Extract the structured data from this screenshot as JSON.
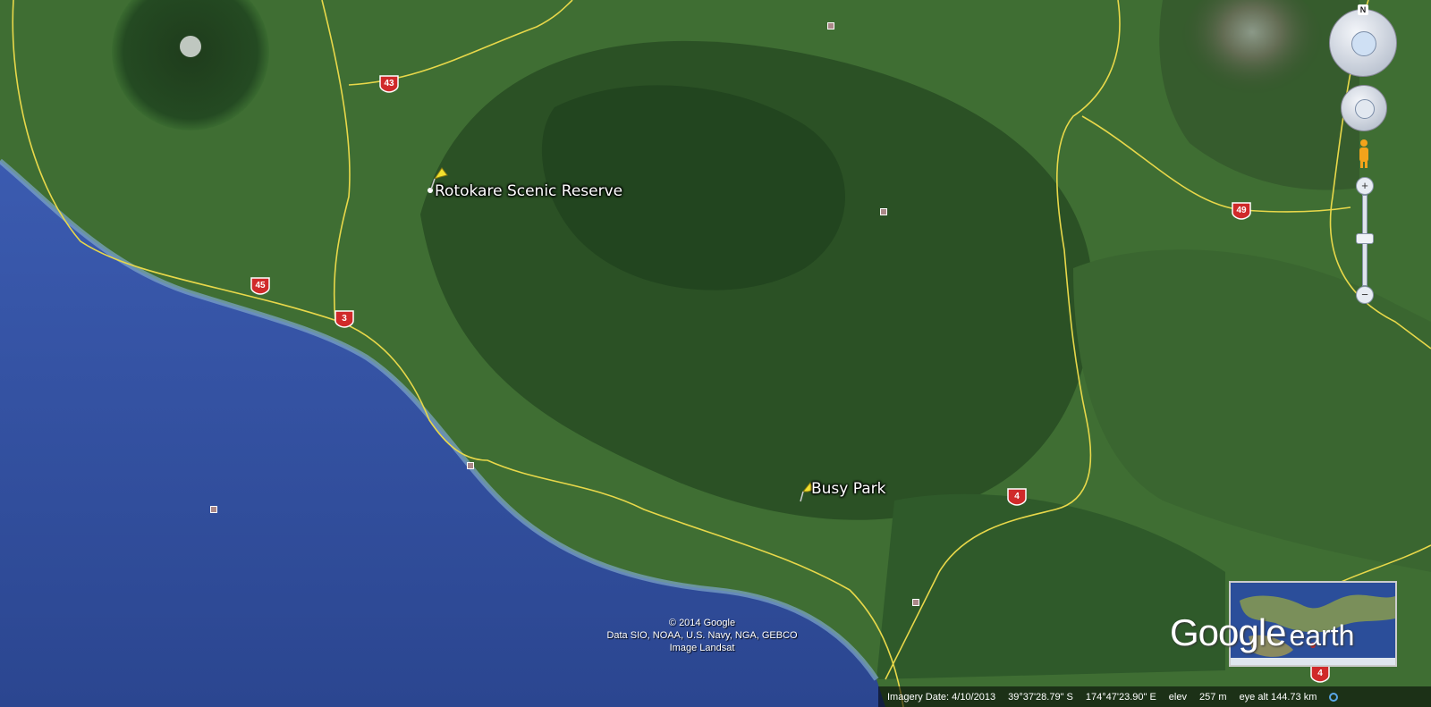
{
  "places": [
    {
      "name": "Rotokare Scenic Reserve"
    },
    {
      "name": "Busy Park"
    }
  ],
  "highways": [
    "43",
    "45",
    "3",
    "4",
    "49",
    "4"
  ],
  "copyright": {
    "line1": "© 2014 Google",
    "line2": "Data SIO, NOAA, U.S. Navy, NGA, GEBCO",
    "line3": "Image Landsat"
  },
  "status": {
    "imagery_date": "Imagery Date: 4/10/2013",
    "lat": "39°37'28.79\" S",
    "lon": "174°47'23.90\" E",
    "elev_label": "elev",
    "elev_value": "257 m",
    "eye_alt": "eye alt 144.73 km"
  },
  "logo": {
    "google": "Google",
    "earth": "earth"
  },
  "nav": {
    "north": "N"
  },
  "colors": {
    "ocean": "#2f4f9e",
    "land": "#3c6a30",
    "roads": "#e8d84a",
    "shield": "#d02a2a"
  }
}
